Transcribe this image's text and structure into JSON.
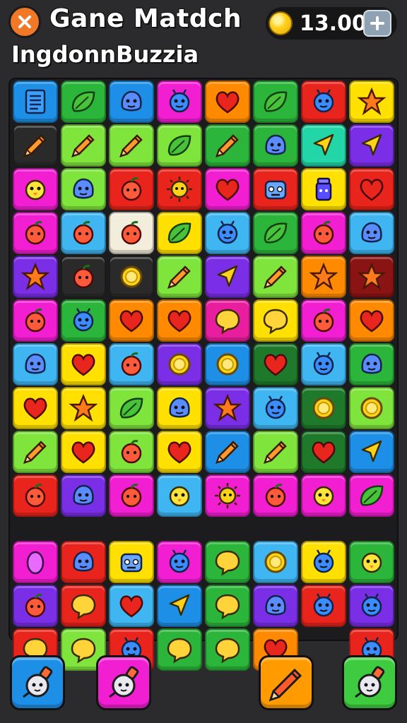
{
  "header": {
    "title": "Gane Matdch",
    "subtitle": "IngdonnBuzzia",
    "coins": "13.00",
    "icons": {
      "close": "close-icon",
      "coin": "coin-icon",
      "add": "plus-icon"
    }
  },
  "colors": {
    "blue": "#1e8fe6",
    "green": "#2bb53a",
    "lime": "#7fe43c",
    "yellow": "#ffe000",
    "orange": "#ff8a00",
    "red": "#e8241c",
    "pink": "#f21ed2",
    "purple": "#7a2ee6",
    "teal": "#22d6a8",
    "dark": "#2a2a2a",
    "white": "#f3eedc",
    "darkgreen": "#1e7a2a",
    "darkred": "#8a1414",
    "sky": "#3fb6f2",
    "magenta": "#e81e9e"
  },
  "board": {
    "rows": [
      [
        [
          "blue",
          "notepad"
        ],
        [
          "green",
          "leaf"
        ],
        [
          "blue",
          "blob"
        ],
        [
          "pink",
          "bug"
        ],
        [
          "orange",
          "heart"
        ],
        [
          "green",
          "leaf"
        ],
        [
          "red",
          "bug"
        ],
        [
          "yellow",
          "star"
        ]
      ],
      [
        [
          "dark",
          "pencil"
        ],
        [
          "lime",
          "pencil"
        ],
        [
          "lime",
          "pencil"
        ],
        [
          "lime",
          "leaf"
        ],
        [
          "green",
          "pencil"
        ],
        [
          "green",
          "blob"
        ],
        [
          "teal",
          "arrow"
        ],
        [
          "purple",
          "arrow"
        ]
      ],
      [
        [
          "pink",
          "chick"
        ],
        [
          "lime",
          "blob"
        ],
        [
          "red",
          "fruit"
        ],
        [
          "red",
          "sun"
        ],
        [
          "pink",
          "heart"
        ],
        [
          "red",
          "robot"
        ],
        [
          "yellow",
          "jar"
        ],
        [
          "red",
          "heart"
        ]
      ],
      [
        [
          "pink",
          "fruit"
        ],
        [
          "sky",
          "fruit"
        ],
        [
          "white",
          "fruit"
        ],
        [
          "yellow",
          "leaf"
        ],
        [
          "sky",
          "bug"
        ],
        [
          "green",
          "leaf"
        ],
        [
          "pink",
          "fruit"
        ],
        [
          "sky",
          "blob"
        ]
      ],
      [
        [
          "purple",
          "star"
        ],
        [
          "dark",
          "fruit"
        ],
        [
          "dark",
          "coin"
        ],
        [
          "lime",
          "pencil"
        ],
        [
          "purple",
          "arrow"
        ],
        [
          "lime",
          "pencil"
        ],
        [
          "orange",
          "star"
        ],
        [
          "darkred",
          "star"
        ]
      ],
      [
        [
          "pink",
          "fruit"
        ],
        [
          "green",
          "bug"
        ],
        [
          "orange",
          "heart"
        ],
        [
          "orange",
          "heart"
        ],
        [
          "magenta",
          "bubble"
        ],
        [
          "yellow",
          "bubble"
        ],
        [
          "pink",
          "fruit"
        ],
        [
          "orange",
          "heart"
        ]
      ],
      [
        [
          "sky",
          "blob"
        ],
        [
          "yellow",
          "heart"
        ],
        [
          "sky",
          "fruit"
        ],
        [
          "purple",
          "coin"
        ],
        [
          "blue",
          "coin"
        ],
        [
          "darkgreen",
          "heart"
        ],
        [
          "sky",
          "bug"
        ],
        [
          "green",
          "blob"
        ]
      ],
      [
        [
          "yellow",
          "heart"
        ],
        [
          "yellow",
          "star"
        ],
        [
          "lime",
          "leaf"
        ],
        [
          "yellow",
          "blob"
        ],
        [
          "purple",
          "star"
        ],
        [
          "sky",
          "bug"
        ],
        [
          "darkgreen",
          "coin"
        ],
        [
          "lime",
          "coin"
        ]
      ],
      [
        [
          "lime",
          "pencil"
        ],
        [
          "yellow",
          "heart"
        ],
        [
          "lime",
          "fruit"
        ],
        [
          "yellow",
          "heart"
        ],
        [
          "blue",
          "pencil"
        ],
        [
          "lime",
          "pencil"
        ],
        [
          "darkgreen",
          "heart"
        ],
        [
          "blue",
          "arrow"
        ]
      ],
      [
        [
          "red",
          "fruit"
        ],
        [
          "purple",
          "blob"
        ],
        [
          "pink",
          "fruit"
        ],
        [
          "sky",
          "chick"
        ],
        [
          "pink",
          "sun"
        ],
        [
          "pink",
          "fruit"
        ],
        [
          "pink",
          "chick"
        ],
        [
          "pink",
          "leaf"
        ]
      ],
      [
        null,
        null,
        null,
        null,
        null,
        null,
        null,
        null
      ],
      [
        [
          "pink",
          "egg"
        ],
        [
          "red",
          "blob"
        ],
        [
          "yellow",
          "robot"
        ],
        [
          "pink",
          "bug"
        ],
        [
          "green",
          "bubble"
        ],
        [
          "sky",
          "coin"
        ],
        [
          "yellow",
          "bug"
        ],
        [
          "green",
          "chick"
        ]
      ],
      [
        [
          "purple",
          "fruit"
        ],
        [
          "red",
          "bubble"
        ],
        [
          "sky",
          "heart"
        ],
        [
          "blue",
          "arrow"
        ],
        [
          "green",
          "bubble"
        ],
        [
          "purple",
          "blob"
        ],
        [
          "red",
          "bug"
        ],
        [
          "purple",
          "bug"
        ]
      ],
      [
        [
          "red",
          "bubble"
        ],
        [
          "lime",
          "bubble"
        ],
        [
          "red",
          "bug"
        ],
        [
          "green",
          "bubble"
        ],
        [
          "green",
          "bubble"
        ],
        [
          "orange",
          "heart"
        ],
        null,
        [
          "red",
          "bug"
        ]
      ]
    ]
  },
  "tools": [
    {
      "color": "#1e8fe6",
      "icon": "lightbulb-icon"
    },
    {
      "color": "#f21ed2",
      "icon": "lightbulb-icon"
    },
    {
      "color": "#ff9a00",
      "icon": "pencil-icon"
    },
    {
      "color": "#3fcb3f",
      "icon": "lightbulb-icon"
    }
  ]
}
